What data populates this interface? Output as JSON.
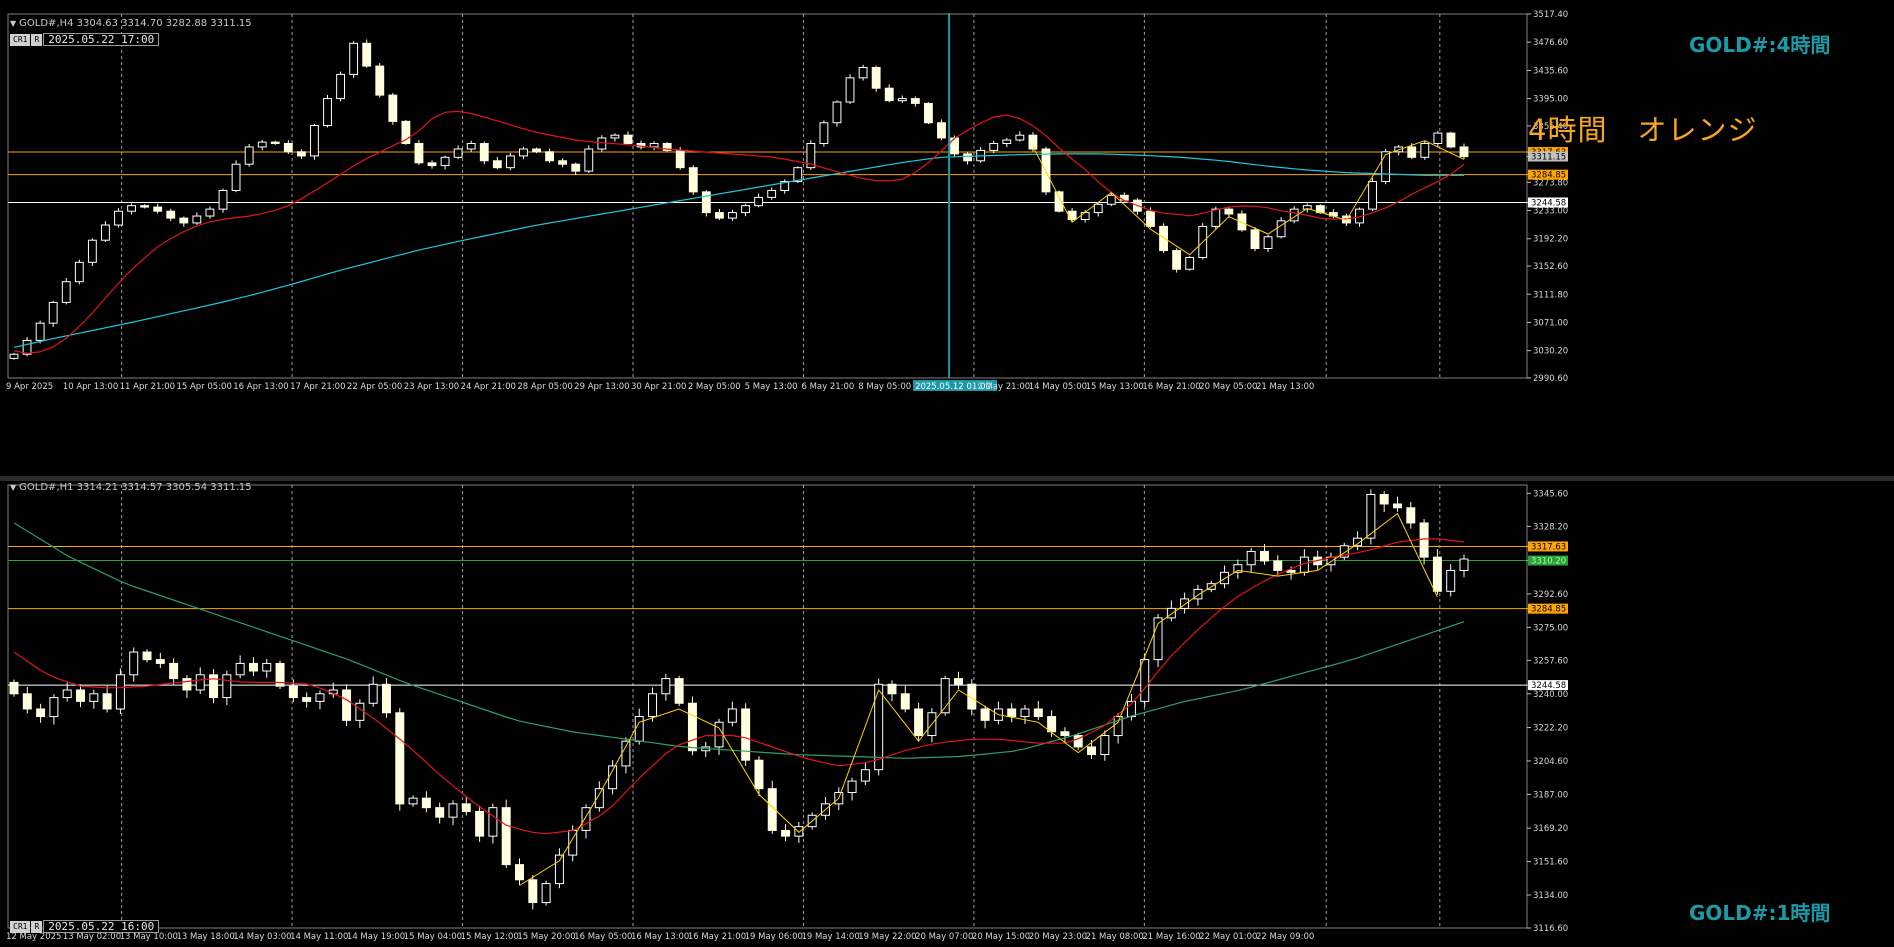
{
  "window": {
    "caption": ""
  },
  "h4": {
    "header": "GOLD#,H4  3304.63 3314.70 3282.88 3311.15",
    "timestamp": "2025.05.22 17:00",
    "cr_label": "CR1",
    "r_label": "R",
    "symbol_label": "GOLD#:4時間",
    "note": "4時間　オレンジ",
    "crosshair_time": "2025.05.12 01:00"
  },
  "h1": {
    "header": "GOLD#,H1  3314.21 3314.57 3305.54 3311.15",
    "timestamp": "2025.05.22 16:00",
    "cr_label": "CR1",
    "r_label": "R",
    "symbol_label": "GOLD#:1時間"
  },
  "colors": {
    "bull": "#ffffff",
    "bull_body": "#000000",
    "bear": "#ffffe0",
    "fast_ma": "#e0141e",
    "slow_ma_h4": "#1ec8dc",
    "slow_ma_h1": "#2e9f6a",
    "level_orange": "#ffa500",
    "level_white": "#ffffff",
    "zigzag": "#ffd400",
    "grid": "#a0a0a0",
    "crosshair": "#1b9aa8"
  },
  "chart_data": [
    {
      "type": "candlestick",
      "symbol": "GOLD#",
      "timeframe": "H4",
      "ylim": [
        2990.6,
        3517.4
      ],
      "yticks": [
        3517.4,
        3476.6,
        3435.6,
        3395.0,
        3355.4,
        3317.63,
        3311.15,
        3284.85,
        3273.8,
        3244.58,
        3233.0,
        3192.2,
        3152.6,
        3111.8,
        3071.0,
        3030.2,
        2990.6
      ],
      "ytick_labels": [
        "3517.40",
        "3476.60",
        "3435.60",
        "3395.00",
        "3355.40",
        "3317.63",
        "3311.15",
        "3284.85",
        "3273.80",
        "3244.58",
        "3233.00",
        "3192.20",
        "3152.60",
        "3111.80",
        "3071.00",
        "3030.20",
        "2990.60"
      ],
      "xtick_labels": [
        "9 Apr 2025",
        "10 Apr 13:00",
        "11 Apr 21:00",
        "15 Apr 05:00",
        "16 Apr 13:00",
        "17 Apr 21:00",
        "22 Apr 05:00",
        "23 Apr 13:00",
        "24 Apr 21:00",
        "28 Apr 05:00",
        "29 Apr 13:00",
        "30 Apr 21:00",
        "2 May 05:00",
        "5 May 13:00",
        "6 May 21:00",
        "8 May 05:00",
        "2025.05.12 01:00",
        "12 May 21:00",
        "14 May 05:00",
        "15 May 13:00",
        "16 May 21:00",
        "20 May 05:00",
        "21 May 13:00"
      ],
      "horizontal_levels": [
        {
          "price": 3317.63,
          "color": "orange",
          "label": "3317.63"
        },
        {
          "price": 3284.85,
          "color": "orange",
          "label": "3284.85"
        },
        {
          "price": 3244.58,
          "color": "white",
          "label": "3244.58"
        }
      ],
      "current_price": "3311.15",
      "series": [
        {
          "name": "",
          "kind": "close",
          "values": [
            3025,
            3045,
            3070,
            3100,
            3130,
            3158,
            3190,
            3212,
            3232,
            3240,
            3238,
            3232,
            3222,
            3215,
            3225,
            3235,
            3262,
            3300,
            3325,
            3332,
            3330,
            3318,
            3312,
            3356,
            3395,
            3430,
            3475,
            3442,
            3400,
            3362,
            3330,
            3302,
            3298,
            3310,
            3322,
            3330,
            3305,
            3295,
            3312,
            3322,
            3318,
            3305,
            3300,
            3290,
            3322,
            3338,
            3342,
            3330,
            3325,
            3330,
            3320,
            3295,
            3260,
            3230,
            3222,
            3230,
            3240,
            3252,
            3262,
            3275,
            3295,
            3330,
            3360,
            3390,
            3425,
            3440,
            3410,
            3392,
            3395,
            3388,
            3360,
            3338,
            3315,
            3305,
            3320,
            3330,
            3335,
            3342,
            3322,
            3260,
            3232,
            3220,
            3230,
            3242,
            3255,
            3248,
            3232,
            3210,
            3175,
            3148,
            3165,
            3210,
            3235,
            3228,
            3205,
            3178,
            3195,
            3218,
            3235,
            3240,
            3230,
            3225,
            3215,
            3235,
            3275,
            3318,
            3325,
            3310,
            3330,
            3345,
            3325,
            3311
          ]
        },
        {
          "name": "",
          "kind": "ma_fast",
          "values": [
            3030,
            3025,
            3033,
            3050,
            3075,
            3105,
            3135,
            3160,
            3182,
            3198,
            3210,
            3218,
            3222,
            3225,
            3230,
            3238,
            3252,
            3268,
            3285,
            3302,
            3315,
            3328,
            3340,
            3365,
            3378,
            3375,
            3368,
            3360,
            3352,
            3345,
            3340,
            3335,
            3332,
            3330,
            3328,
            3325,
            3322,
            3320,
            3318,
            3316,
            3314,
            3312,
            3310,
            3305,
            3300,
            3292,
            3285,
            3278,
            3275,
            3278,
            3292,
            3315,
            3340,
            3355,
            3368,
            3372,
            3360,
            3340,
            3315,
            3295,
            3270,
            3250,
            3240,
            3230,
            3228,
            3225,
            3232,
            3238,
            3240,
            3238,
            3232,
            3228,
            3222,
            3220,
            3222,
            3230,
            3240,
            3255,
            3268,
            3280,
            3300
          ]
        },
        {
          "name": "",
          "kind": "ma_slow",
          "values": [
            3035,
            3048,
            3060,
            3072,
            3085,
            3098,
            3112,
            3128,
            3145,
            3160,
            3175,
            3188,
            3200,
            3212,
            3222,
            3232,
            3242,
            3252,
            3262,
            3272,
            3282,
            3292,
            3302,
            3310,
            3312,
            3314,
            3315,
            3315,
            3313,
            3310,
            3305,
            3298,
            3292,
            3288,
            3286,
            3284,
            3284
          ]
        }
      ]
    },
    {
      "type": "candlestick",
      "symbol": "GOLD#",
      "timeframe": "H1",
      "ylim": [
        3116.6,
        3350.0
      ],
      "yticks": [
        3345.6,
        3328.2,
        3317.63,
        3310.2,
        3292.6,
        3284.85,
        3275.0,
        3257.6,
        3244.58,
        3240.0,
        3222.2,
        3204.6,
        3187.0,
        3169.2,
        3151.6,
        3134.0,
        3116.6
      ],
      "ytick_labels": [
        "3345.60",
        "3328.20",
        "3317.63",
        "3310.20",
        "3292.60",
        "3284.85",
        "3275.00",
        "3257.60",
        "3244.58",
        "3240.00",
        "3222.20",
        "3204.60",
        "3187.00",
        "3169.20",
        "3151.60",
        "3134.00",
        "3116.60"
      ],
      "xtick_labels": [
        "12 May 2025",
        "13 May 02:00",
        "13 May 10:00",
        "13 May 18:00",
        "14 May 03:00",
        "14 May 11:00",
        "14 May 19:00",
        "15 May 04:00",
        "15 May 12:00",
        "15 May 20:00",
        "16 May 05:00",
        "16 May 13:00",
        "16 May 21:00",
        "19 May 06:00",
        "19 May 14:00",
        "19 May 22:00",
        "20 May 07:00",
        "20 May 15:00",
        "20 May 23:00",
        "21 May 08:00",
        "21 May 16:00",
        "22 May 01:00",
        "22 May 09:00"
      ],
      "horizontal_levels": [
        {
          "price": 3317.63,
          "color": "orange",
          "label": "3317.63"
        },
        {
          "price": 3284.85,
          "color": "orange",
          "label": "3284.85"
        },
        {
          "price": 3244.58,
          "color": "white",
          "label": "3244.58"
        }
      ],
      "current_price": "3310.20",
      "series": [
        {
          "name": "",
          "kind": "close",
          "values": [
            3240,
            3232,
            3228,
            3238,
            3242,
            3236,
            3240,
            3232,
            3250,
            3262,
            3258,
            3256,
            3248,
            3242,
            3250,
            3238,
            3250,
            3256,
            3252,
            3256,
            3244,
            3238,
            3236,
            3240,
            3242,
            3226,
            3235,
            3245,
            3230,
            3182,
            3185,
            3180,
            3175,
            3182,
            3178,
            3165,
            3180,
            3150,
            3142,
            3130,
            3140,
            3155,
            3168,
            3180,
            3190,
            3202,
            3215,
            3228,
            3240,
            3248,
            3235,
            3210,
            3212,
            3225,
            3232,
            3205,
            3190,
            3168,
            3165,
            3170,
            3176,
            3182,
            3188,
            3194,
            3200,
            3245,
            3240,
            3232,
            3218,
            3230,
            3248,
            3245,
            3232,
            3226,
            3232,
            3228,
            3232,
            3228,
            3220,
            3218,
            3212,
            3208,
            3218,
            3228,
            3236,
            3258,
            3280,
            3285,
            3290,
            3295,
            3298,
            3304,
            3308,
            3315,
            3310,
            3305,
            3304,
            3312,
            3308,
            3312,
            3318,
            3322,
            3345,
            3340,
            3338,
            3330,
            3312,
            3294,
            3305,
            3311
          ]
        },
        {
          "name": "",
          "kind": "ma_fast",
          "values": [
            3262,
            3250,
            3244,
            3243,
            3244,
            3246,
            3248,
            3246,
            3246,
            3245,
            3238,
            3226,
            3212,
            3196,
            3182,
            3170,
            3166,
            3168,
            3178,
            3196,
            3212,
            3218,
            3218,
            3212,
            3206,
            3202,
            3204,
            3210,
            3214,
            3216,
            3216,
            3214,
            3214,
            3222,
            3236,
            3258,
            3275,
            3290,
            3300,
            3308,
            3312,
            3315,
            3320,
            3322,
            3320
          ]
        },
        {
          "name": "",
          "kind": "ma_slow",
          "values": [
            3330,
            3312,
            3298,
            3288,
            3278,
            3268,
            3258,
            3246,
            3236,
            3226,
            3220,
            3216,
            3212,
            3210,
            3208,
            3207,
            3206,
            3207,
            3210,
            3218,
            3228,
            3236,
            3242,
            3250,
            3258,
            3268,
            3278
          ]
        }
      ]
    }
  ]
}
